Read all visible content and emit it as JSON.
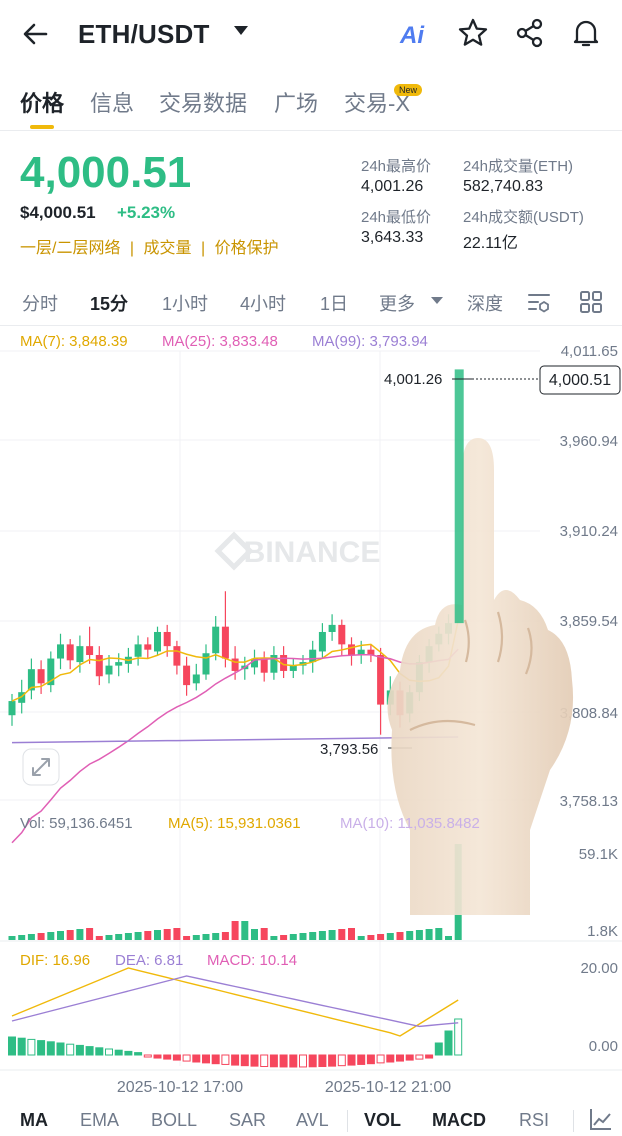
{
  "header": {
    "pair": "ETH/USDT",
    "ai_label": "Ai",
    "icons": [
      "back-arrow-icon",
      "dropdown-caret-icon",
      "ai-icon",
      "star-icon",
      "share-icon",
      "bell-icon"
    ]
  },
  "tabs": [
    {
      "label": "价格",
      "active": true
    },
    {
      "label": "信息"
    },
    {
      "label": "交易数据"
    },
    {
      "label": "广场"
    },
    {
      "label": "交易-X",
      "badge": "New"
    }
  ],
  "price": {
    "last": "4,000.51",
    "usd": "$4,000.51",
    "change": "+5.23%",
    "links": [
      "一层/二层网络",
      "成交量",
      "价格保护"
    ],
    "stats": [
      {
        "label": "24h最高价",
        "value": "4,001.26"
      },
      {
        "label": "24h成交量(ETH)",
        "value": "582,740.83"
      },
      {
        "label": "24h最低价",
        "value": "3,643.33"
      },
      {
        "label": "24h成交额(USDT)",
        "value": "22.11亿"
      }
    ]
  },
  "time_tabs": [
    "分时",
    "15分",
    "1小时",
    "4小时",
    "1日",
    "更多",
    "深度"
  ],
  "active_time_tab": "15分",
  "ma_legend": {
    "ma7": "MA(7): 3,848.39",
    "ma25": "MA(25): 3,833.48",
    "ma99": "MA(99): 3,793.94"
  },
  "price_axis": [
    "4,011.65",
    "3,960.94",
    "3,910.24",
    "3,859.54",
    "3,808.84",
    "3,758.13"
  ],
  "price_tag": "4,000.51",
  "high_marker": "4,001.26",
  "low_marker": "3,793.56",
  "watermark": "BINANCE",
  "volume_legend": {
    "vol": "Vol: 59,136.6451",
    "ma5": "MA(5): 15,931.0361",
    "ma10": "MA(10): 11,035.8482"
  },
  "volume_axis": [
    "59.1K",
    "1.8K"
  ],
  "macd_legend": {
    "dif": "DIF: 16.96",
    "dea": "DEA: 6.81",
    "macd": "MACD: 10.14"
  },
  "macd_axis": [
    "20.00",
    "0.00"
  ],
  "time_labels": [
    "2025-10-12 17:00",
    "2025-10-12 21:00"
  ],
  "indicator_tabs": [
    {
      "label": "MA",
      "active": true
    },
    {
      "label": "EMA"
    },
    {
      "label": "BOLL"
    },
    {
      "label": "SAR"
    },
    {
      "label": "AVL"
    },
    {
      "label": "VOL",
      "active": true
    },
    {
      "label": "MACD",
      "active": true
    },
    {
      "label": "RSI"
    }
  ],
  "colors": {
    "up": "#2ebd85",
    "down": "#f6465d",
    "ma7": "#f0b90b",
    "ma25": "#e05fb5",
    "ma99": "#9b7fd4",
    "brand": "#f0b90b"
  },
  "chart_data": {
    "type": "candlestick",
    "interval": "15分",
    "price_axis_ticks": [
      4011.65,
      3960.94,
      3910.24,
      3859.54,
      3808.84,
      3758.13
    ],
    "candles": [
      [
        3806,
        3814,
        3800,
        3818
      ],
      [
        3813,
        3819,
        3807,
        3826
      ],
      [
        3820,
        3832,
        3815,
        3838
      ],
      [
        3832,
        3824,
        3818,
        3837
      ],
      [
        3823,
        3838,
        3819,
        3842
      ],
      [
        3838,
        3846,
        3832,
        3852
      ],
      [
        3846,
        3837,
        3832,
        3849
      ],
      [
        3836,
        3845,
        3830,
        3851
      ],
      [
        3845,
        3840,
        3835,
        3856
      ],
      [
        3840,
        3828,
        3823,
        3845
      ],
      [
        3829,
        3834,
        3824,
        3840
      ],
      [
        3834,
        3836,
        3828,
        3841
      ],
      [
        3835,
        3839,
        3830,
        3844
      ],
      [
        3839,
        3846,
        3834,
        3851
      ],
      [
        3846,
        3843,
        3838,
        3850
      ],
      [
        3842,
        3853,
        3840,
        3856
      ],
      [
        3853,
        3845,
        3839,
        3857
      ],
      [
        3845,
        3834,
        3829,
        3848
      ],
      [
        3834,
        3823,
        3817,
        3839
      ],
      [
        3824,
        3829,
        3820,
        3835
      ],
      [
        3829,
        3841,
        3826,
        3846
      ],
      [
        3841,
        3856,
        3837,
        3862
      ],
      [
        3856,
        3838,
        3833,
        3876
      ],
      [
        3838,
        3831,
        3826,
        3845
      ],
      [
        3832,
        3834,
        3826,
        3839
      ],
      [
        3833,
        3838,
        3829,
        3843
      ],
      [
        3838,
        3830,
        3825,
        3842
      ],
      [
        3830,
        3840,
        3826,
        3845
      ],
      [
        3840,
        3831,
        3827,
        3845
      ],
      [
        3831,
        3834,
        3827,
        3838
      ],
      [
        3834,
        3836,
        3829,
        3840
      ],
      [
        3836,
        3843,
        3830,
        3848
      ],
      [
        3842,
        3853,
        3838,
        3858
      ],
      [
        3853,
        3857,
        3848,
        3863
      ],
      [
        3857,
        3846,
        3840,
        3860
      ],
      [
        3846,
        3840,
        3834,
        3850
      ],
      [
        3840,
        3843,
        3835,
        3848
      ],
      [
        3843,
        3840,
        3836,
        3846
      ],
      [
        3840,
        3812,
        3795,
        3844
      ],
      [
        3812,
        3820,
        3806,
        3828
      ],
      [
        3820,
        3806,
        3799,
        3825
      ],
      [
        3807,
        3819,
        3802,
        3823
      ],
      [
        3819,
        3836,
        3814,
        3840
      ],
      [
        3836,
        3845,
        3830,
        3849
      ],
      [
        3846,
        3852,
        3842,
        3856
      ],
      [
        3852,
        3858,
        3846,
        3863
      ],
      [
        3858,
        4000.51,
        3853,
        4001.26
      ]
    ],
    "volume_axis_ticks": [
      59100,
      1800
    ],
    "volume_last": 59136.6451,
    "macd_axis_ticks": [
      20.0,
      0.0
    ],
    "dif_last": 16.96,
    "dea_last": 6.81,
    "macd_last": 10.14,
    "x_tick_labels": [
      "2025-10-12 17:00",
      "2025-10-12 21:00"
    ]
  }
}
